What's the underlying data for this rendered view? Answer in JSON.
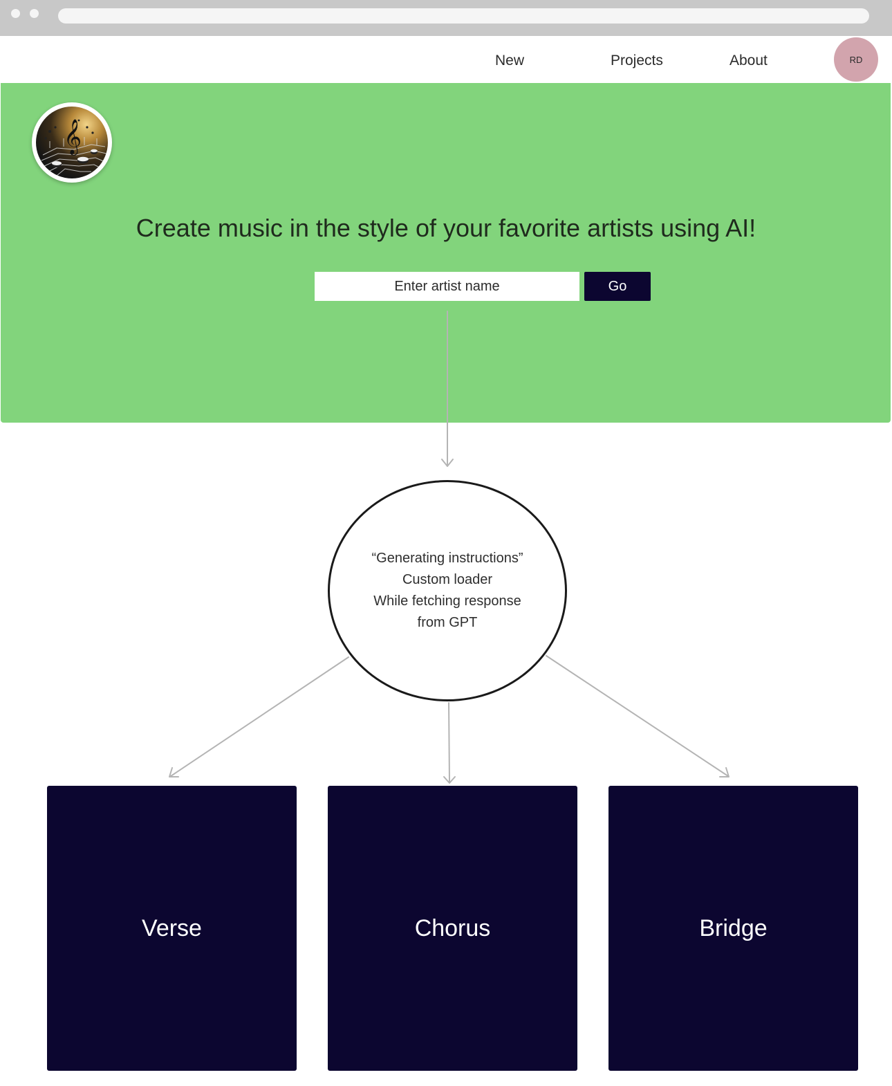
{
  "nav": {
    "links": [
      {
        "label": "New"
      },
      {
        "label": "Projects"
      },
      {
        "label": "About"
      }
    ],
    "avatar_initials": "RD",
    "avatar_color": "#d2a4ad"
  },
  "hero": {
    "background_color": "#82d47c",
    "logo_icon": "music-circuit-logo-icon",
    "headline": "Create music in the style of your favorite artists using AI!",
    "search": {
      "placeholder": "Enter artist name",
      "value": ""
    },
    "go_label": "Go",
    "accent_color": "#0c0630"
  },
  "loader": {
    "lines": [
      "“Generating instructions”",
      "Custom loader",
      "While fetching response",
      "from GPT"
    ]
  },
  "sections": [
    {
      "label": "Verse"
    },
    {
      "label": "Chorus"
    },
    {
      "label": "Bridge"
    }
  ]
}
